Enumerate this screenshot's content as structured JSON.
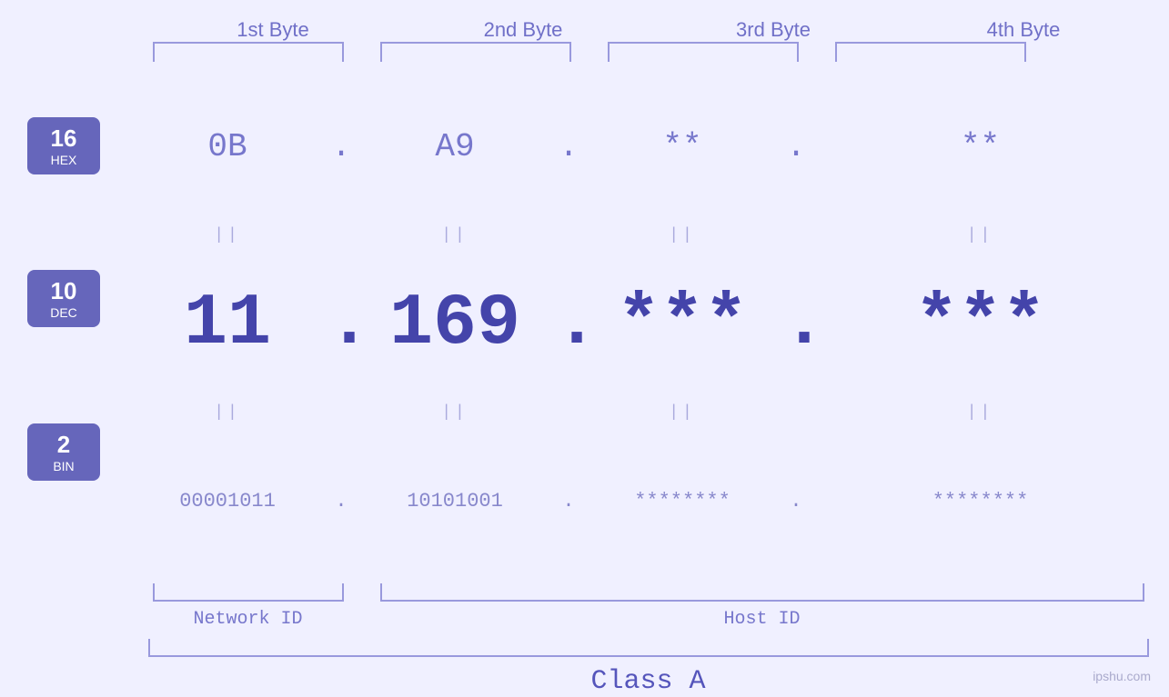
{
  "headers": {
    "byte1": "1st Byte",
    "byte2": "2nd Byte",
    "byte3": "3rd Byte",
    "byte4": "4th Byte"
  },
  "bases": {
    "hex": {
      "number": "16",
      "label": "HEX"
    },
    "dec": {
      "number": "10",
      "label": "DEC"
    },
    "bin": {
      "number": "2",
      "label": "BIN"
    }
  },
  "hex_row": {
    "b1": "0B",
    "b2": "A9",
    "b3": "**",
    "b4": "**",
    "sep": "."
  },
  "dec_row": {
    "b1": "11",
    "b2": "169",
    "b3": "***",
    "b4": "***",
    "sep": "."
  },
  "bin_row": {
    "b1": "00001011",
    "b2": "10101001",
    "b3": "********",
    "b4": "********",
    "sep": "."
  },
  "labels": {
    "network_id": "Network ID",
    "host_id": "Host ID",
    "class": "Class A"
  },
  "watermark": "ipshu.com",
  "equals_symbol": "||"
}
